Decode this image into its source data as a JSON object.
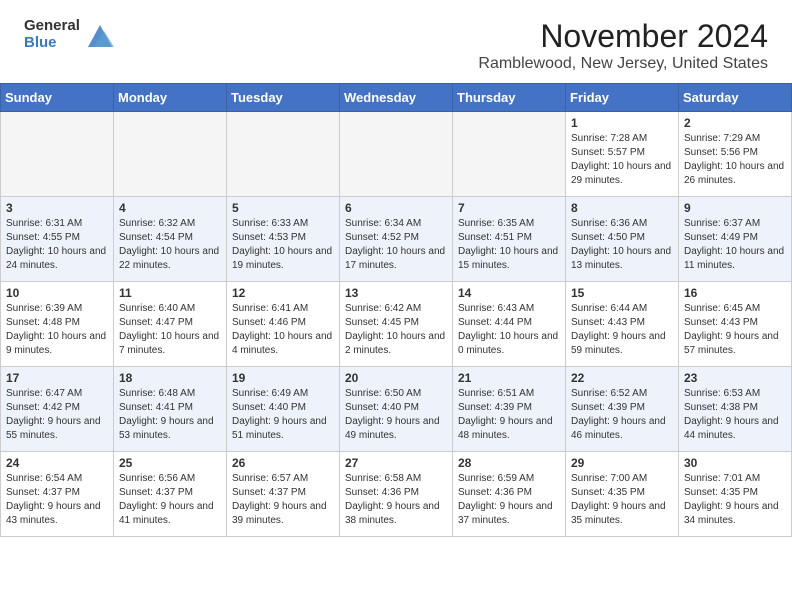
{
  "header": {
    "logo_general": "General",
    "logo_blue": "Blue",
    "month_title": "November 2024",
    "location": "Ramblewood, New Jersey, United States"
  },
  "calendar": {
    "days_of_week": [
      "Sunday",
      "Monday",
      "Tuesday",
      "Wednesday",
      "Thursday",
      "Friday",
      "Saturday"
    ],
    "rows": [
      {
        "alt": false,
        "days": [
          {
            "num": "",
            "info": "",
            "empty": true
          },
          {
            "num": "",
            "info": "",
            "empty": true
          },
          {
            "num": "",
            "info": "",
            "empty": true
          },
          {
            "num": "",
            "info": "",
            "empty": true
          },
          {
            "num": "",
            "info": "",
            "empty": true
          },
          {
            "num": "1",
            "info": "Sunrise: 7:28 AM\nSunset: 5:57 PM\nDaylight: 10 hours and 29 minutes.",
            "empty": false
          },
          {
            "num": "2",
            "info": "Sunrise: 7:29 AM\nSunset: 5:56 PM\nDaylight: 10 hours and 26 minutes.",
            "empty": false
          }
        ]
      },
      {
        "alt": true,
        "days": [
          {
            "num": "3",
            "info": "Sunrise: 6:31 AM\nSunset: 4:55 PM\nDaylight: 10 hours and 24 minutes.",
            "empty": false
          },
          {
            "num": "4",
            "info": "Sunrise: 6:32 AM\nSunset: 4:54 PM\nDaylight: 10 hours and 22 minutes.",
            "empty": false
          },
          {
            "num": "5",
            "info": "Sunrise: 6:33 AM\nSunset: 4:53 PM\nDaylight: 10 hours and 19 minutes.",
            "empty": false
          },
          {
            "num": "6",
            "info": "Sunrise: 6:34 AM\nSunset: 4:52 PM\nDaylight: 10 hours and 17 minutes.",
            "empty": false
          },
          {
            "num": "7",
            "info": "Sunrise: 6:35 AM\nSunset: 4:51 PM\nDaylight: 10 hours and 15 minutes.",
            "empty": false
          },
          {
            "num": "8",
            "info": "Sunrise: 6:36 AM\nSunset: 4:50 PM\nDaylight: 10 hours and 13 minutes.",
            "empty": false
          },
          {
            "num": "9",
            "info": "Sunrise: 6:37 AM\nSunset: 4:49 PM\nDaylight: 10 hours and 11 minutes.",
            "empty": false
          }
        ]
      },
      {
        "alt": false,
        "days": [
          {
            "num": "10",
            "info": "Sunrise: 6:39 AM\nSunset: 4:48 PM\nDaylight: 10 hours and 9 minutes.",
            "empty": false
          },
          {
            "num": "11",
            "info": "Sunrise: 6:40 AM\nSunset: 4:47 PM\nDaylight: 10 hours and 7 minutes.",
            "empty": false
          },
          {
            "num": "12",
            "info": "Sunrise: 6:41 AM\nSunset: 4:46 PM\nDaylight: 10 hours and 4 minutes.",
            "empty": false
          },
          {
            "num": "13",
            "info": "Sunrise: 6:42 AM\nSunset: 4:45 PM\nDaylight: 10 hours and 2 minutes.",
            "empty": false
          },
          {
            "num": "14",
            "info": "Sunrise: 6:43 AM\nSunset: 4:44 PM\nDaylight: 10 hours and 0 minutes.",
            "empty": false
          },
          {
            "num": "15",
            "info": "Sunrise: 6:44 AM\nSunset: 4:43 PM\nDaylight: 9 hours and 59 minutes.",
            "empty": false
          },
          {
            "num": "16",
            "info": "Sunrise: 6:45 AM\nSunset: 4:43 PM\nDaylight: 9 hours and 57 minutes.",
            "empty": false
          }
        ]
      },
      {
        "alt": true,
        "days": [
          {
            "num": "17",
            "info": "Sunrise: 6:47 AM\nSunset: 4:42 PM\nDaylight: 9 hours and 55 minutes.",
            "empty": false
          },
          {
            "num": "18",
            "info": "Sunrise: 6:48 AM\nSunset: 4:41 PM\nDaylight: 9 hours and 53 minutes.",
            "empty": false
          },
          {
            "num": "19",
            "info": "Sunrise: 6:49 AM\nSunset: 4:40 PM\nDaylight: 9 hours and 51 minutes.",
            "empty": false
          },
          {
            "num": "20",
            "info": "Sunrise: 6:50 AM\nSunset: 4:40 PM\nDaylight: 9 hours and 49 minutes.",
            "empty": false
          },
          {
            "num": "21",
            "info": "Sunrise: 6:51 AM\nSunset: 4:39 PM\nDaylight: 9 hours and 48 minutes.",
            "empty": false
          },
          {
            "num": "22",
            "info": "Sunrise: 6:52 AM\nSunset: 4:39 PM\nDaylight: 9 hours and 46 minutes.",
            "empty": false
          },
          {
            "num": "23",
            "info": "Sunrise: 6:53 AM\nSunset: 4:38 PM\nDaylight: 9 hours and 44 minutes.",
            "empty": false
          }
        ]
      },
      {
        "alt": false,
        "days": [
          {
            "num": "24",
            "info": "Sunrise: 6:54 AM\nSunset: 4:37 PM\nDaylight: 9 hours and 43 minutes.",
            "empty": false
          },
          {
            "num": "25",
            "info": "Sunrise: 6:56 AM\nSunset: 4:37 PM\nDaylight: 9 hours and 41 minutes.",
            "empty": false
          },
          {
            "num": "26",
            "info": "Sunrise: 6:57 AM\nSunset: 4:37 PM\nDaylight: 9 hours and 39 minutes.",
            "empty": false
          },
          {
            "num": "27",
            "info": "Sunrise: 6:58 AM\nSunset: 4:36 PM\nDaylight: 9 hours and 38 minutes.",
            "empty": false
          },
          {
            "num": "28",
            "info": "Sunrise: 6:59 AM\nSunset: 4:36 PM\nDaylight: 9 hours and 37 minutes.",
            "empty": false
          },
          {
            "num": "29",
            "info": "Sunrise: 7:00 AM\nSunset: 4:35 PM\nDaylight: 9 hours and 35 minutes.",
            "empty": false
          },
          {
            "num": "30",
            "info": "Sunrise: 7:01 AM\nSunset: 4:35 PM\nDaylight: 9 hours and 34 minutes.",
            "empty": false
          }
        ]
      }
    ]
  }
}
